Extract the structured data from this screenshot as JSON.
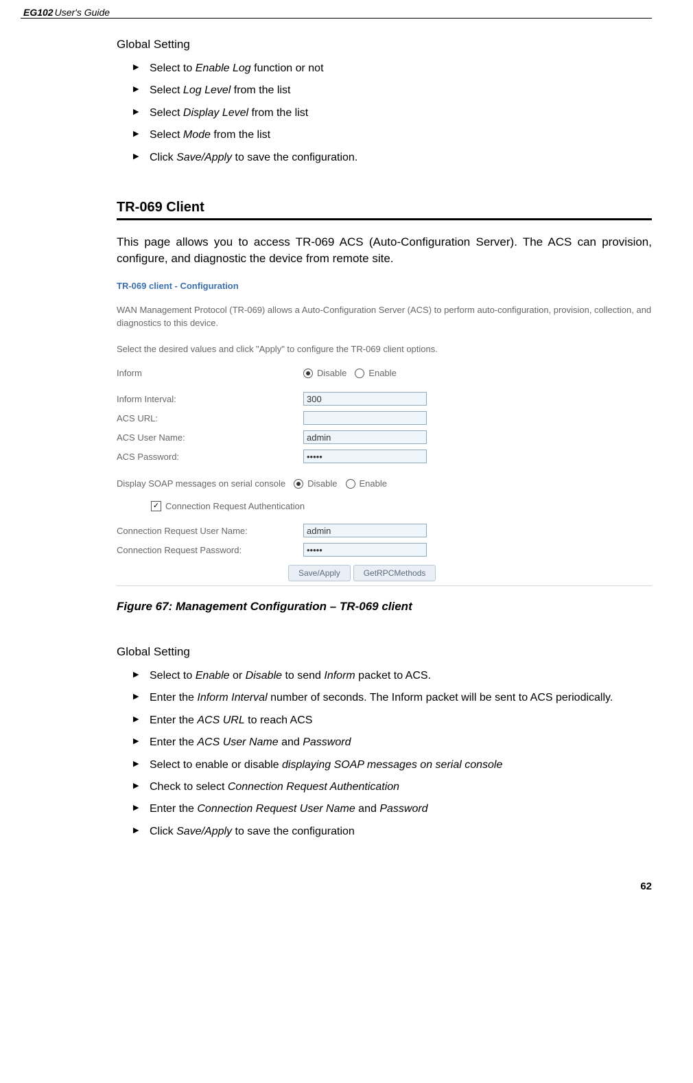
{
  "header": {
    "product": "EG102",
    "subtitle": " User's Guide"
  },
  "top_section_label": "Global Setting",
  "top_list": [
    {
      "pre": "Select to ",
      "em": "Enable Log",
      "post": " function or not"
    },
    {
      "pre": "Select ",
      "em": "Log Level",
      "post": " from the list"
    },
    {
      "pre": "Select ",
      "em": "Display Level",
      "post": " from the list"
    },
    {
      "pre": "Select ",
      "em": "Mode",
      "post": " from the list"
    },
    {
      "pre": "Click ",
      "em": "Save/Apply",
      "post": " to save the configuration."
    }
  ],
  "h2": "TR-069 Client",
  "intro_paragraph": "This page allows you to access TR-069 ACS (Auto-Configuration Server). The ACS can provision, configure, and diagnostic the device from remote site.",
  "screenshot": {
    "title": "TR-069 client - Configuration",
    "desc1": "WAN Management Protocol (TR-069) allows a Auto-Configuration Server (ACS) to perform auto-configuration, provision, collection, and diagnostics to this device.",
    "desc2": "Select the desired values and click \"Apply\" to configure the TR-069 client options.",
    "rows": {
      "inform_label": "Inform",
      "disable": "Disable",
      "enable": "Enable",
      "interval_label": "Inform Interval:",
      "interval_value": "300",
      "acs_url_label": "ACS URL:",
      "acs_url_value": "",
      "acs_user_label": "ACS User Name:",
      "acs_user_value": "admin",
      "acs_pass_label": "ACS Password:",
      "acs_pass_value": "•••••",
      "soap_label": "Display SOAP messages on serial console",
      "conn_auth_label": "Connection Request Authentication",
      "conn_user_label": "Connection Request User Name:",
      "conn_user_value": "admin",
      "conn_pass_label": "Connection Request Password:",
      "conn_pass_value": "•••••"
    },
    "buttons": {
      "save": "Save/Apply",
      "rpc": "GetRPCMethods"
    }
  },
  "figure_caption": "Figure 67: Management Configuration – TR-069 client",
  "bottom_section_label": "Global Setting",
  "bottom_list": {
    "i1": {
      "a": "Select to ",
      "b": "Enable",
      "c": " or ",
      "d": "Disable",
      "e": " to send ",
      "f": "Inform",
      "g": " packet to ACS."
    },
    "i2": {
      "a": "Enter the ",
      "b": "Inform Interval",
      "c": " number of seconds. The Inform packet will be sent to ACS periodically."
    },
    "i3": {
      "a": "Enter the ",
      "b": "ACS URL",
      "c": " to reach ACS"
    },
    "i4": {
      "a": "Enter the ",
      "b": "ACS User Name",
      "c": " and ",
      "d": "Password"
    },
    "i5": {
      "a": "Select to enable or disable ",
      "b": "displaying SOAP messages on serial console"
    },
    "i6": {
      "a": "Check to select ",
      "b": "Connection Request Authentication"
    },
    "i7": {
      "a": "Enter the ",
      "b": "Connection Request User Name",
      "c": " and ",
      "d": "Password"
    },
    "i8": {
      "a": "Click ",
      "b": "Save/Apply",
      "c": " to save the configuration"
    }
  },
  "page_number": "62"
}
